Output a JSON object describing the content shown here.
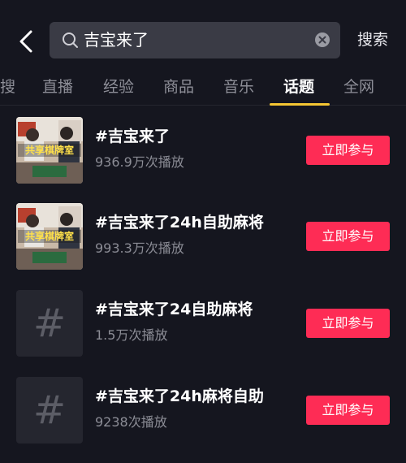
{
  "search": {
    "query": "吉宝来了",
    "button_label": "搜索"
  },
  "tabs": [
    {
      "label": "搜"
    },
    {
      "label": "直播"
    },
    {
      "label": "经验"
    },
    {
      "label": "商品"
    },
    {
      "label": "音乐"
    },
    {
      "label": "话题",
      "active": true
    },
    {
      "label": "全网"
    }
  ],
  "results": [
    {
      "title": "#吉宝来了",
      "plays": "936.9万次播放",
      "thumb_text": "共享棋牌室",
      "join_label": "立即参与"
    },
    {
      "title": "#吉宝来了24h自助麻将",
      "plays": "993.3万次播放",
      "thumb_text": "共享棋牌室",
      "join_label": "立即参与"
    },
    {
      "title": "#吉宝来了24自助麻将",
      "plays": "1.5万次播放",
      "thumb_text": "#",
      "join_label": "立即参与"
    },
    {
      "title": "#吉宝来了24h麻将自助",
      "plays": "9238次播放",
      "thumb_text": "#",
      "join_label": "立即参与"
    }
  ],
  "colors": {
    "background": "#15161f",
    "accent": "#fe2c55",
    "tab_indicator": "#f5c633"
  }
}
